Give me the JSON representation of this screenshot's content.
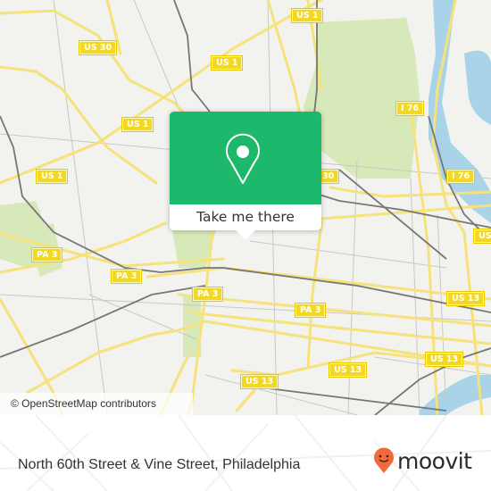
{
  "map": {
    "attribution": "© OpenStreetMap contributors",
    "road_shields": [
      {
        "id": "us1-top",
        "label": "US 1"
      },
      {
        "id": "us30-top",
        "label": "US 30"
      },
      {
        "id": "us1-upper",
        "label": "US 1"
      },
      {
        "id": "us1-mid",
        "label": "US 1"
      },
      {
        "id": "us1-left",
        "label": "US 1"
      },
      {
        "id": "i76-upper",
        "label": "I 76"
      },
      {
        "id": "us30-right",
        "label": "30"
      },
      {
        "id": "i76-lower",
        "label": "I 76"
      },
      {
        "id": "us-right-edge",
        "label": "US"
      },
      {
        "id": "pa3-left",
        "label": "PA 3"
      },
      {
        "id": "pa3-mid",
        "label": "PA 3"
      },
      {
        "id": "pa3-center",
        "label": "PA 3"
      },
      {
        "id": "pa3-right",
        "label": "PA 3"
      },
      {
        "id": "us13-right-upper",
        "label": "US 13"
      },
      {
        "id": "us13-right-lower",
        "label": "US 13"
      },
      {
        "id": "us13-center",
        "label": "US 13"
      },
      {
        "id": "us13-left",
        "label": "US 13"
      }
    ],
    "colors": {
      "land": "#f2f2ef",
      "park": "#d7e9b9",
      "water": "#a8d3e8",
      "road": "#f6e27a",
      "rail": "#777777"
    }
  },
  "popup": {
    "action_label": "Take me there",
    "accent": "#1db86b"
  },
  "footer": {
    "location_title": "North 60th Street & Vine Street, Philadelphia",
    "brand": "moovit",
    "brand_color": "#f26a3b"
  }
}
